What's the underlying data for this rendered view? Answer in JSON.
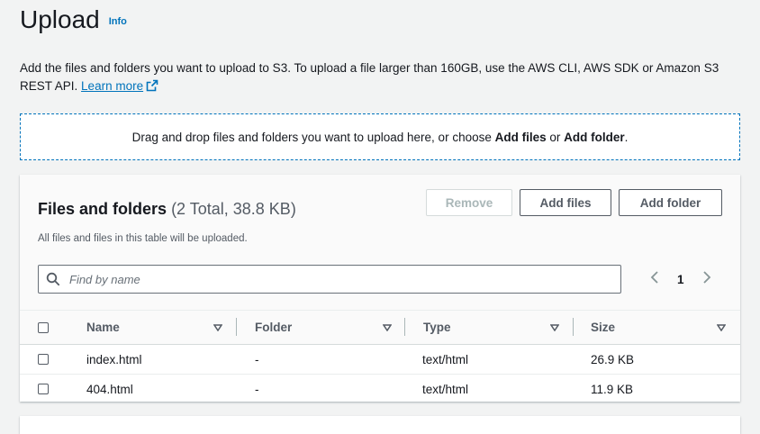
{
  "page": {
    "title": "Upload",
    "info_link": "Info",
    "description": "Add the files and folders you want to upload to S3. To upload a file larger than 160GB, use the AWS CLI, AWS SDK or Amazon S3 REST API.",
    "learn_more": "Learn more"
  },
  "dropzone": {
    "text_before": "Drag and drop files and folders you want to upload here, or choose ",
    "add_files": "Add files",
    "or": " or ",
    "add_folder": "Add folder",
    "end": "."
  },
  "files_panel": {
    "title": "Files and folders",
    "count": "(2 Total, 38.8 KB)",
    "subtitle": "All files and files in this table will be uploaded.",
    "buttons": {
      "remove": "Remove",
      "add_files": "Add files",
      "add_folder": "Add folder"
    },
    "search_placeholder": "Find by name",
    "pagination": {
      "current_page": "1"
    },
    "columns": [
      "Name",
      "Folder",
      "Type",
      "Size"
    ],
    "rows": [
      {
        "name": "index.html",
        "folder": "-",
        "type": "text/html",
        "size": "26.9 KB"
      },
      {
        "name": "404.html",
        "folder": "-",
        "type": "text/html",
        "size": "11.9 KB"
      }
    ]
  },
  "colors": {
    "link": "#0073bb",
    "text": "#16191f",
    "muted": "#545b64",
    "disabled": "#aab7b8"
  }
}
